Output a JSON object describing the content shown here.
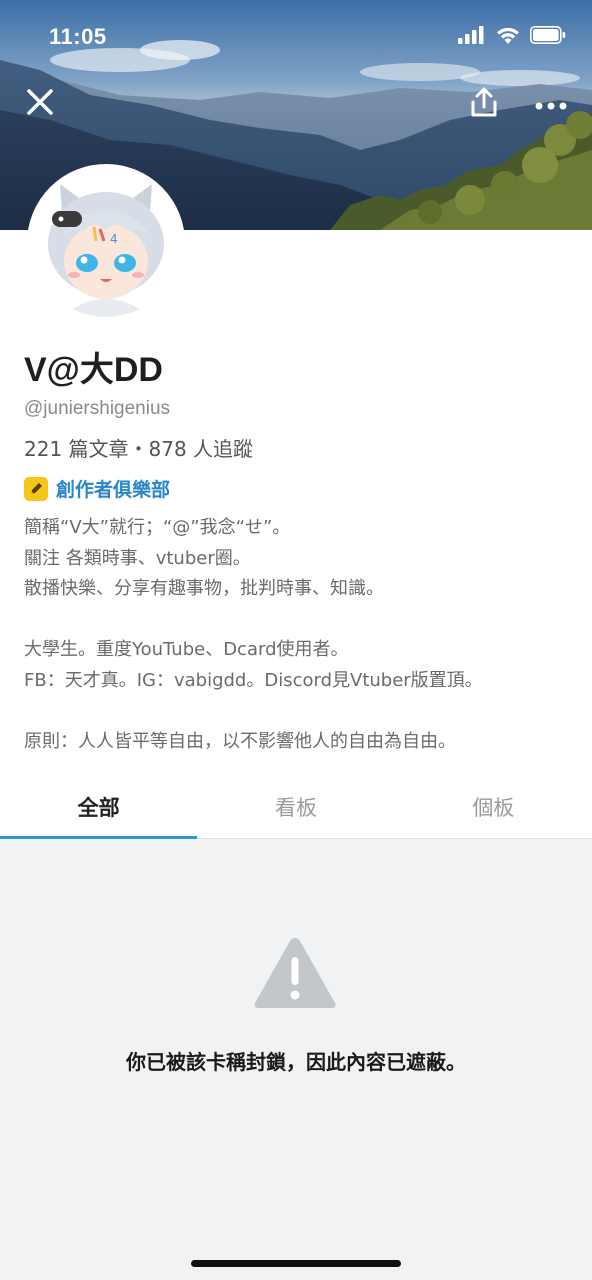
{
  "status_bar": {
    "time": "11:05",
    "icons": [
      "signal-icon",
      "wifi-icon",
      "battery-icon"
    ]
  },
  "header": {
    "close_icon": "close-icon",
    "share_icon": "share-icon",
    "more_icon": "more-icon"
  },
  "profile": {
    "name": "V@大DD",
    "handle": "@juniershigenius",
    "stats": "221 篇文章・878 人追蹤",
    "badge": {
      "icon": "pen-icon",
      "label": "創作者俱樂部",
      "color": "#f5c518"
    },
    "bio": [
      "簡稱“V大”就行；“@”我念“せ”。",
      "關注 各類時事、vtuber圈。",
      "散播快樂、分享有趣事物，批判時事、知識。",
      "",
      "大學生。重度YouTube、Dcard使用者。",
      "FB：天才真。IG：vabigdd。Discord見Vtuber版置頂。",
      "",
      "原則：人人皆平等自由，以不影響他人的自由為自由。"
    ]
  },
  "tabs": [
    {
      "label": "全部",
      "active": true
    },
    {
      "label": "看板",
      "active": false
    },
    {
      "label": "個板",
      "active": false
    }
  ],
  "content": {
    "warning_icon": "warning-icon",
    "message": "你已被該卡稱封鎖，因此內容已遮蔽。"
  },
  "colors": {
    "accent": "#3397cf",
    "badge_label": "#2a86c8",
    "content_bg": "#f1f2f4"
  }
}
